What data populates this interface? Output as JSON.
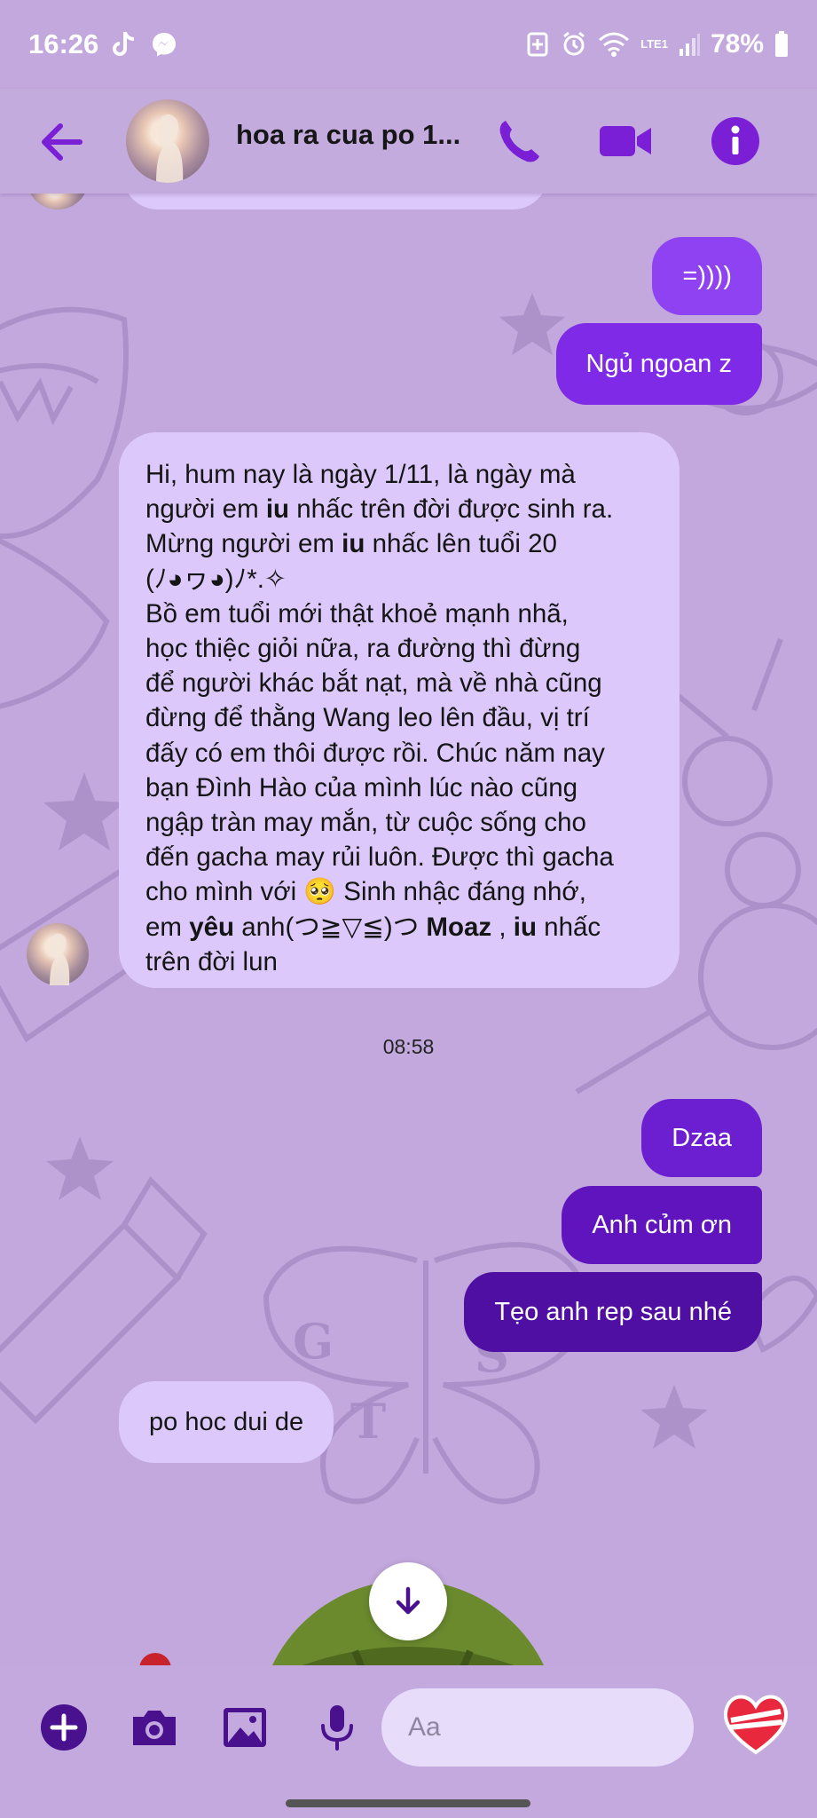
{
  "status_bar": {
    "time": "16:26",
    "battery": "78%",
    "network": "LTE1",
    "icons": [
      "tiktok-icon",
      "messenger-icon",
      "battery-saver-icon",
      "alarm-icon",
      "wifi-icon",
      "signal-icon",
      "battery-icon"
    ]
  },
  "header": {
    "title": "hoa ra cua po 1...",
    "icons": [
      "back-arrow-icon",
      "phone-icon",
      "video-icon",
      "info-icon"
    ]
  },
  "messages": [
    {
      "id": "m1",
      "direction": "out",
      "text": "=))))"
    },
    {
      "id": "m2",
      "direction": "out",
      "text": "Ngủ ngoan z"
    },
    {
      "id": "m3",
      "direction": "in",
      "lines": [
        "Hi, hum nay là ngày 1/11, là ngày mà",
        "người em |iu| nhấc trên đời được sinh ra.",
        "Mừng người em |iu| nhấc lên tuổi 20",
        "(ﾉ◕ヮ◕)ﾉ*.✧",
        "Bồ em tuổi mới thật khoẻ mạnh nhã,",
        "học thiệc giỏi nữa, ra đường thì đừng",
        "để người khác bắt nạt, mà về nhà cũng",
        "đừng để thằng Wang leo lên đầu, vị trí",
        "đấy có em thôi được rồi. Chúc năm nay",
        "bạn Đình Hào của mình lúc nào cũng",
        "ngập tràn may mắn, từ cuộc sống cho",
        "đến gacha may rủi luôn. Được thì gacha",
        "cho mình với 🥺 Sinh nhậc đáng nhớ,",
        "em |yêu| anh(つ≧▽≦)つ  |Moaz| , |iu| nhấc",
        "trên đời lun"
      ]
    },
    {
      "id": "m4",
      "direction": "out",
      "text": "Dzaa"
    },
    {
      "id": "m5",
      "direction": "out",
      "text": "Anh củm ơn"
    },
    {
      "id": "m6",
      "direction": "out",
      "text": "Tẹo anh rep sau nhé"
    },
    {
      "id": "m7",
      "direction": "in",
      "text": "po hoc dui de"
    }
  ],
  "timestamp": "08:58",
  "composer": {
    "placeholder": "Aa",
    "icons": [
      "add-icon",
      "camera-icon",
      "gallery-icon",
      "microphone-icon",
      "heart-reaction-icon"
    ]
  },
  "scroll_button": {
    "icon": "arrow-down-icon"
  },
  "colors": {
    "background": "#c2a8dc",
    "outgoing_bubble_top": "#8b3bf0",
    "outgoing_bubble_bottom": "#4e0e9e",
    "incoming_bubble": "#dcc8fa",
    "accent": "#7a1fd6"
  }
}
